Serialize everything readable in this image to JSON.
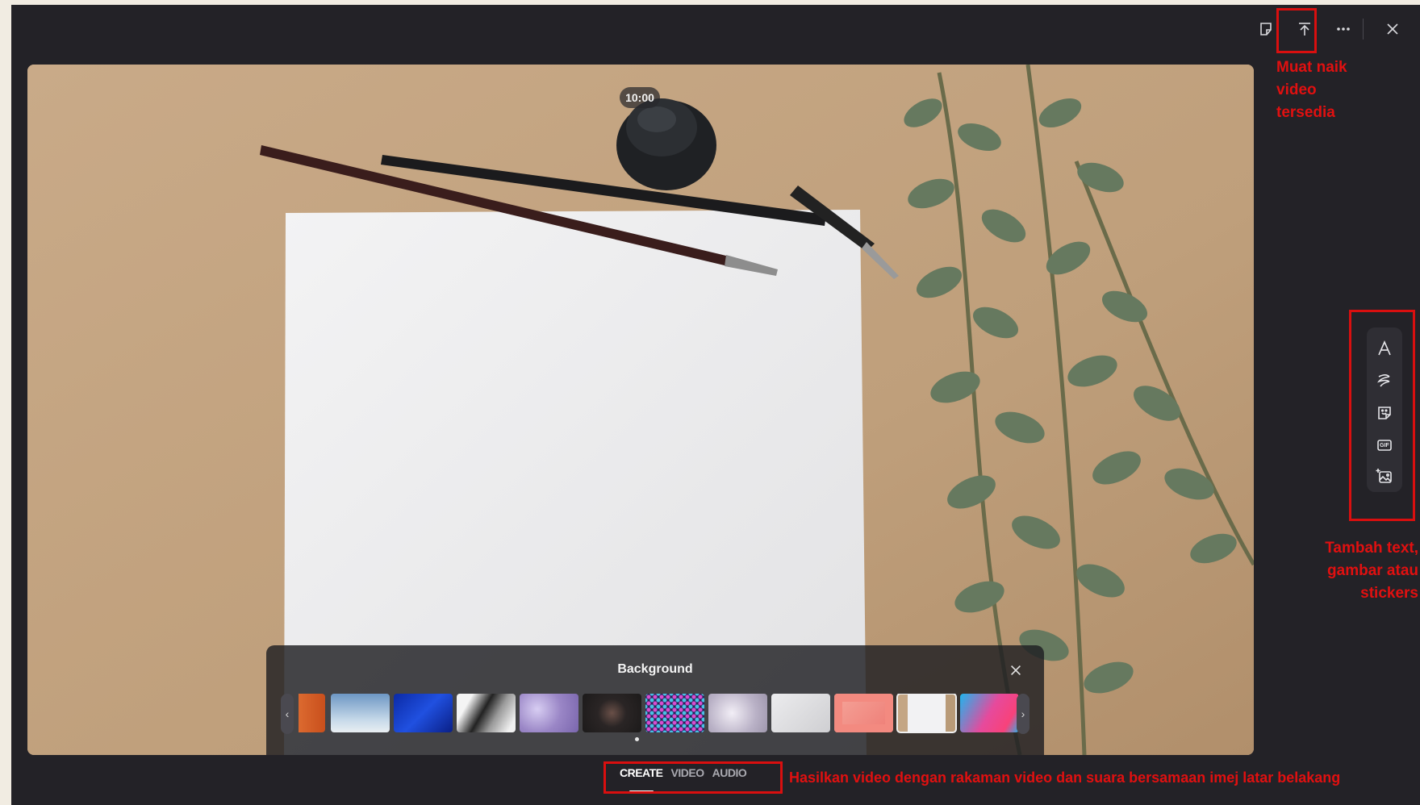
{
  "toolbar": {
    "items": [
      {
        "name": "sticky-note",
        "icon": "note-icon"
      },
      {
        "name": "upload",
        "icon": "upload-icon"
      },
      {
        "name": "more",
        "icon": "more-icon"
      },
      {
        "name": "close",
        "icon": "close-icon"
      }
    ]
  },
  "stage": {
    "timer": "10:00"
  },
  "background_panel": {
    "title": "Background",
    "thumbnails": [
      {
        "name": "orange",
        "color": "#d8642c"
      },
      {
        "name": "sky-gradient",
        "color": "#7fa3c6"
      },
      {
        "name": "blue-wave",
        "color": "#1336b8"
      },
      {
        "name": "ink-splash",
        "color": "#8d8d8d"
      },
      {
        "name": "purple-glitter",
        "color": "#a493c9"
      },
      {
        "name": "fireworks",
        "color": "#2b2727"
      },
      {
        "name": "sequins",
        "color": "#3a2c6b"
      },
      {
        "name": "crystal",
        "color": "#c8c3d3"
      },
      {
        "name": "desk-flatlay",
        "color": "#dcdcde"
      },
      {
        "name": "coral-frame",
        "color": "#f08c84"
      },
      {
        "name": "paper-pens",
        "color": "#c9b49a",
        "selected": true
      },
      {
        "name": "colorful-gradient",
        "color": "#2fa6e8"
      }
    ]
  },
  "side_tools": [
    {
      "name": "text",
      "icon": "text-icon"
    },
    {
      "name": "pen",
      "icon": "pen-icon"
    },
    {
      "name": "sticker",
      "icon": "sticker-icon"
    },
    {
      "name": "gif",
      "icon": "gif-icon",
      "label": "GIF"
    },
    {
      "name": "image",
      "icon": "image-add-icon"
    }
  ],
  "tabs": [
    {
      "label": "CREATE",
      "active": true
    },
    {
      "label": "VIDEO",
      "active": false
    },
    {
      "label": "AUDIO",
      "active": false
    }
  ],
  "annotations": {
    "upload_note_line1": "Muat naik",
    "upload_note_line2": "video",
    "upload_note_line3": "tersedia",
    "tools_note_line1": "Tambah text,",
    "tools_note_line2": "gambar atau",
    "tools_note_line3": "stickers",
    "tabs_note": "Hasilkan video dengan rakaman video dan suara bersamaan imej latar belakang",
    "color": "#d90f0f"
  }
}
